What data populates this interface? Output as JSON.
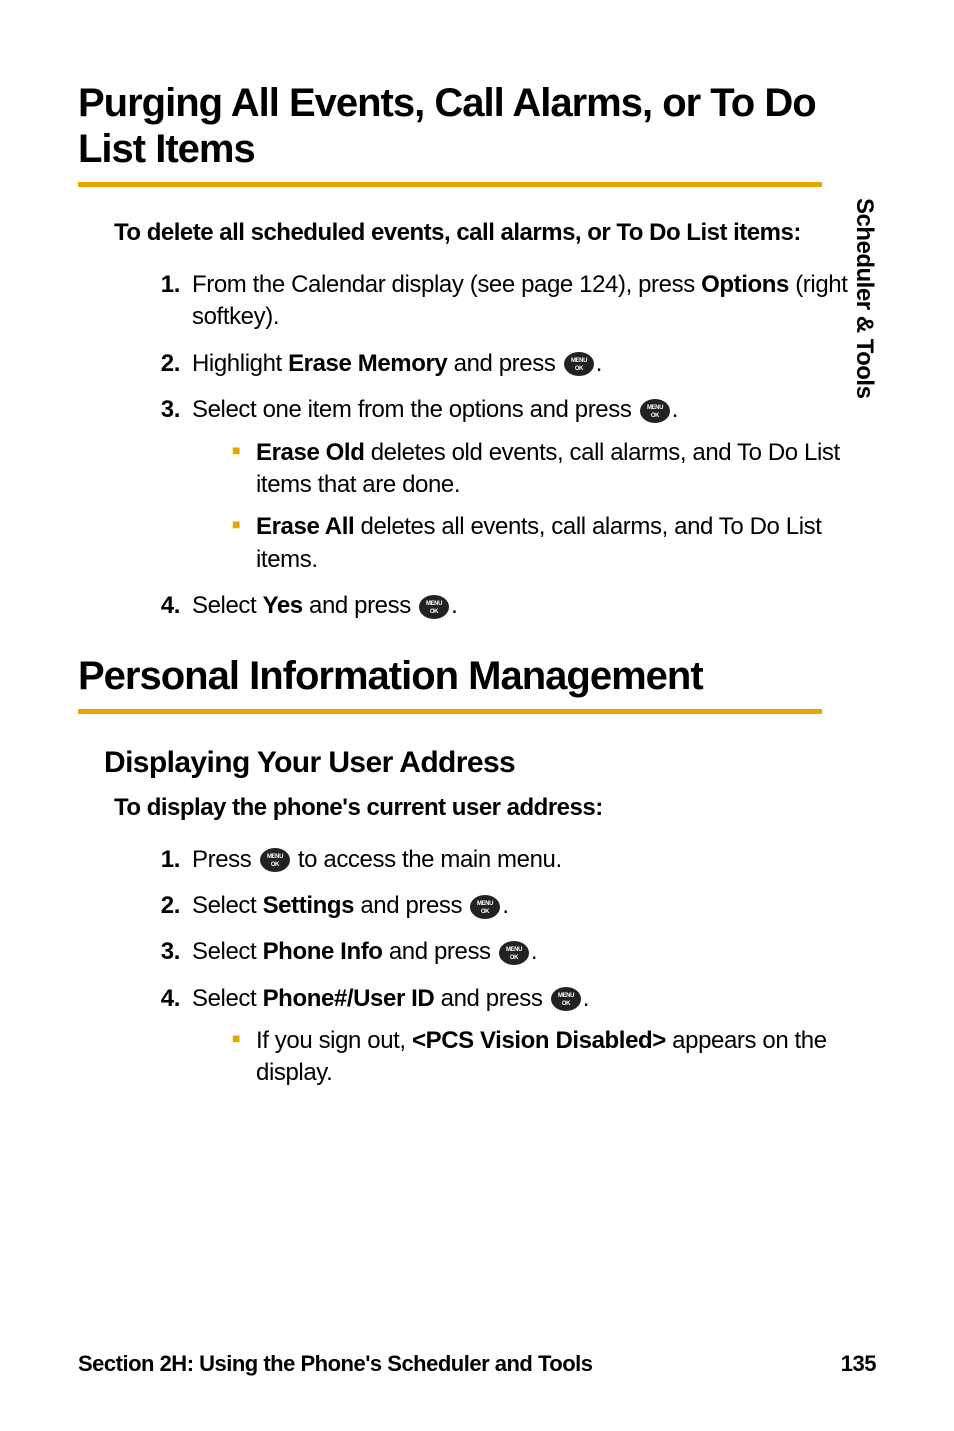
{
  "side_tab": "Scheduler & Tools",
  "section1": {
    "title": "Purging All Events, Call Alarms, or To Do List Items",
    "intro": "To delete all scheduled events, call alarms, or To Do List items:",
    "steps": {
      "s1": {
        "num": "1.",
        "pre": "From the Calendar display (see page 124), press ",
        "bold": "Options",
        "post": " (right softkey)."
      },
      "s2": {
        "num": "2.",
        "pre": "Highlight ",
        "bold": "Erase Memory",
        "post": " and press ",
        "tail": "."
      },
      "s3": {
        "num": "3.",
        "pre": "Select one item from the options and press ",
        "tail": ".",
        "sub": {
          "a": {
            "bold": "Erase Old",
            "text": " deletes old events, call alarms, and To Do List items that are done."
          },
          "b": {
            "bold": "Erase All",
            "text": " deletes all events, call alarms, and To Do List items."
          }
        }
      },
      "s4": {
        "num": "4.",
        "pre": "Select ",
        "bold": "Yes",
        "post": " and press ",
        "tail": "."
      }
    }
  },
  "section2": {
    "title": "Personal Information Management",
    "subhead": "Displaying Your User Address",
    "intro": "To display the phone's current user address:",
    "steps": {
      "s1": {
        "num": "1.",
        "pre": "Press ",
        "post": " to access the main menu."
      },
      "s2": {
        "num": "2.",
        "pre": "Select ",
        "bold": "Settings",
        "post": " and press ",
        "tail": "."
      },
      "s3": {
        "num": "3.",
        "pre": "Select ",
        "bold": "Phone Info",
        "post": " and press ",
        "tail": "."
      },
      "s4": {
        "num": "4.",
        "pre": "Select ",
        "bold": "Phone#/User ID",
        "post": " and press ",
        "tail": ".",
        "sub": {
          "a": {
            "pre": "If you sign out, ",
            "bold": "<PCS Vision Disabled>",
            "post": " appears on the display."
          }
        }
      }
    }
  },
  "footer": {
    "section": "Section 2H: Using the Phone's Scheduler and Tools",
    "page": "135"
  },
  "icons": {
    "menu_ok": "MENU OK"
  }
}
